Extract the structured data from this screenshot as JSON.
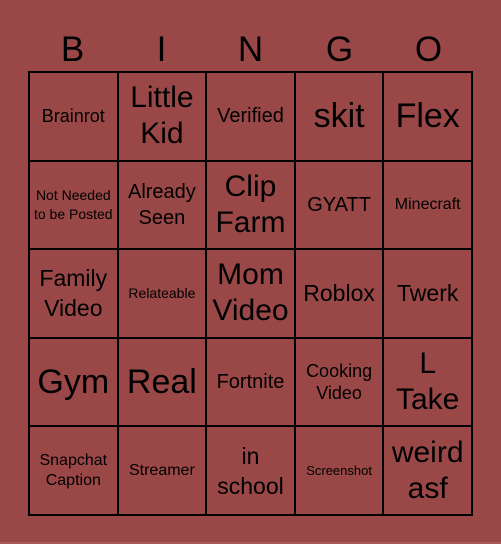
{
  "header": {
    "letters": [
      "B",
      "I",
      "N",
      "G",
      "O"
    ]
  },
  "board": {
    "rows": [
      [
        "Brainrot",
        "Little Kid",
        "Verified",
        "skit",
        "Flex"
      ],
      [
        "Not Needed to be Posted",
        "Already Seen",
        "Clip Farm",
        "GYATT",
        "Minecraft"
      ],
      [
        "Family Video",
        "Relateable",
        "Mom Video",
        "Roblox",
        "Twerk"
      ],
      [
        "Gym",
        "Real",
        "Fortnite",
        "Cooking Video",
        "L Take"
      ],
      [
        "Snapchat Caption",
        "Streamer",
        "in school",
        "Screenshot",
        "weird asf"
      ]
    ]
  },
  "colors": {
    "background": "#994747",
    "grid_lines": "#000000",
    "text": "#000000"
  }
}
